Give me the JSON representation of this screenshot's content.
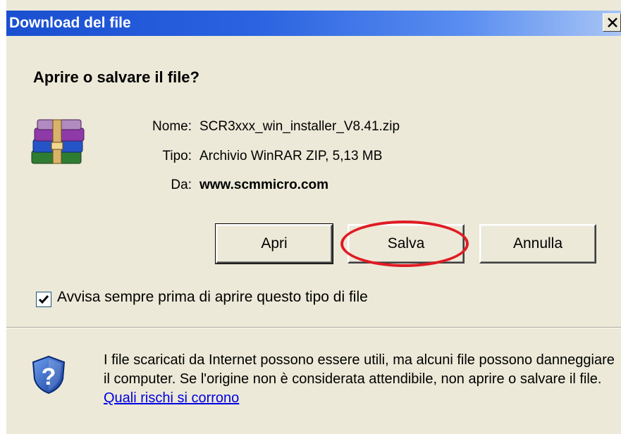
{
  "window": {
    "title": "Download del file",
    "close_icon": "close-icon"
  },
  "dialog": {
    "heading": "Aprire o salvare il file?",
    "file_icon": "winrar-archive-icon",
    "fields": {
      "name_label": "Nome:",
      "name_value": "SCR3xxx_win_installer_V8.41.zip",
      "type_label": "Tipo:",
      "type_value": "Archivio WinRAR ZIP, 5,13 MB",
      "from_label": "Da:",
      "from_value": "www.scmmicro.com"
    },
    "buttons": {
      "open": "Apri",
      "save": "Salva",
      "cancel": "Annulla"
    },
    "checkbox": {
      "label": "Avvisa sempre prima di aprire questo tipo di file",
      "checked": true
    },
    "warning": {
      "icon": "shield-question-icon",
      "text": "I file scaricati da Internet possono essere utili, ma alcuni file possono danneggiare il computer. Se l'origine non è considerata attendibile, non aprire o salvare il file. ",
      "link": "Quali rischi si corrono"
    },
    "annotation_color": "#e01b24"
  }
}
